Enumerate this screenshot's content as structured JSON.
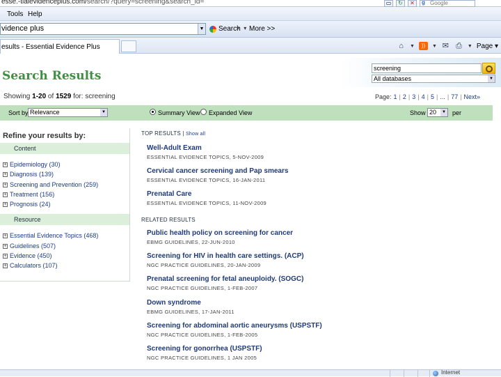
{
  "browser": {
    "address_visible": "esse.-tialevidenceplus.com/search/?query=screening&search_id=",
    "address_prefix": "esse.-tialevidenceplus.com/",
    "address_rest": "search/?query=screening&search_id=",
    "google_box": "Google",
    "menu": {
      "tools": "Tools",
      "help": "Help"
    },
    "toolbar": {
      "field_value": "vidence plus",
      "search_label": "Search",
      "drop_marks": "▾ ▾",
      "more_label": "More >>"
    },
    "tab_title": "esults - Essential Evidence Plus",
    "page_menu": "Page ▾",
    "status_zone": "Internet"
  },
  "page": {
    "title": "Search Results",
    "search": {
      "query": "screening",
      "database": "All databases"
    },
    "showing": {
      "prefix": "Showing ",
      "range": "1-20",
      "of_text": " of ",
      "total": "1529",
      "for_text": " for: screening"
    },
    "pager": {
      "label": "Page:",
      "pages": [
        "1",
        "2",
        "3",
        "4",
        "5"
      ],
      "ellipsis": "...",
      "last": "77",
      "next": "Next»"
    },
    "sort": {
      "label": "Sort by",
      "value": "Relevance"
    },
    "views": {
      "summary": "Summary View",
      "expanded": "Expanded View"
    },
    "show": {
      "label": "Show",
      "value": "20",
      "suffix": "per"
    },
    "refine": {
      "title": "Refine your results by:",
      "content_head": "Content",
      "content_items": [
        {
          "label": "Epidemiology (30)"
        },
        {
          "label": "Diagnosis (139)"
        },
        {
          "label": "Screening and Prevention (259)"
        },
        {
          "label": "Treatment (156)"
        },
        {
          "label": "Prognosis (24)"
        }
      ],
      "resource_head": "Resource",
      "resource_items": [
        {
          "label": "Essential Evidence Topics (468)"
        },
        {
          "label": "Guidelines (507)"
        },
        {
          "label": "Evidence (450)"
        },
        {
          "label": "Calculators (107)"
        }
      ]
    },
    "top_results": {
      "heading": "TOP RESULTS | ",
      "show_all": "Show all",
      "items": [
        {
          "title": "Well-Adult Exam",
          "meta": "ESSENTIAL EVIDENCE TOPICS, 5-NOV-2009"
        },
        {
          "title": "Cervical cancer screening and Pap smears",
          "meta": "ESSENTIAL EVIDENCE TOPICS, 16-JAN-2011"
        },
        {
          "title": "Prenatal Care",
          "meta": "ESSENTIAL EVIDENCE TOPICS, 11-NOV-2009"
        }
      ]
    },
    "related_results": {
      "heading": "RELATED RESULTS",
      "items": [
        {
          "title": "Public health policy on screening for cancer",
          "meta": "EBMG GUIDELINES, 22-JUN-2010"
        },
        {
          "title": "Screening for HIV in health care settings. (ACP)",
          "meta": "NGC PRACTICE GUIDELINES, 20-JAN-2009"
        },
        {
          "title": "Prenatal screening for fetal aneuploidy. (SOGC)",
          "meta": "NGC PRACTICE GUIDELINES, 1-FEB-2007"
        },
        {
          "title": "Down syndrome",
          "meta": "EBMG GUIDELINES, 17-JAN-2011"
        },
        {
          "title": "Screening for abdominal aortic aneurysms (USPSTF)",
          "meta": "NGC PRACTICE GUIDELINES, 1-FEB-2005"
        },
        {
          "title": "Screening for gonorrhea (USPSTF)",
          "meta": "NGC PRACTICE GUIDELINES, 1 JAN 2005"
        }
      ]
    }
  },
  "colors": {
    "title_green": "#3f8f42",
    "sort_bar": "#bfe0bd",
    "facet_head": "#dcefdb",
    "link": "#1a3a8a"
  }
}
